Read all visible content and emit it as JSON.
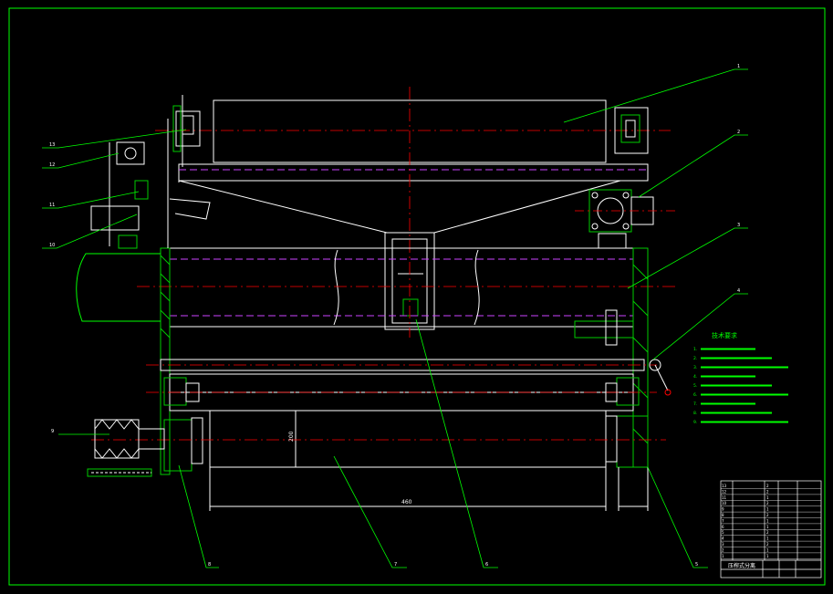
{
  "drawing": {
    "background": "#000000",
    "colors": {
      "outline": "#ffffff",
      "leader": "#00ff00",
      "centerline": "#ff0000",
      "hidden": "#cc44ff",
      "section": "#00cc00",
      "dimension": "#ffffff"
    },
    "balloons": [
      "1",
      "2",
      "3",
      "4",
      "5",
      "6",
      "7",
      "8",
      "9",
      "10",
      "11",
      "12",
      "13"
    ],
    "dimensions": {
      "roller_length": "460",
      "roller_diameter": "200"
    },
    "notes": {
      "heading": "技术要求",
      "items": [
        "1.",
        "2.",
        "3.",
        "4.",
        "5.",
        "6.",
        "7.",
        "8.",
        "9."
      ]
    },
    "title_block": {
      "drawing_name": "压榨式分离",
      "rows": [
        [
          "13",
          "",
          "2",
          ""
        ],
        [
          "12",
          "",
          "2",
          ""
        ],
        [
          "11",
          "",
          "1",
          ""
        ],
        [
          "10",
          "",
          "2",
          ""
        ],
        [
          "9",
          "",
          "1",
          ""
        ],
        [
          "8",
          "",
          "2",
          ""
        ],
        [
          "7",
          "",
          "1",
          ""
        ],
        [
          "6",
          "",
          "1",
          ""
        ],
        [
          "5",
          "",
          "2",
          ""
        ],
        [
          "4",
          "",
          "1",
          ""
        ],
        [
          "3",
          "",
          "2",
          ""
        ],
        [
          "2",
          "",
          "1",
          ""
        ],
        [
          "1",
          "",
          "1",
          ""
        ]
      ]
    }
  }
}
